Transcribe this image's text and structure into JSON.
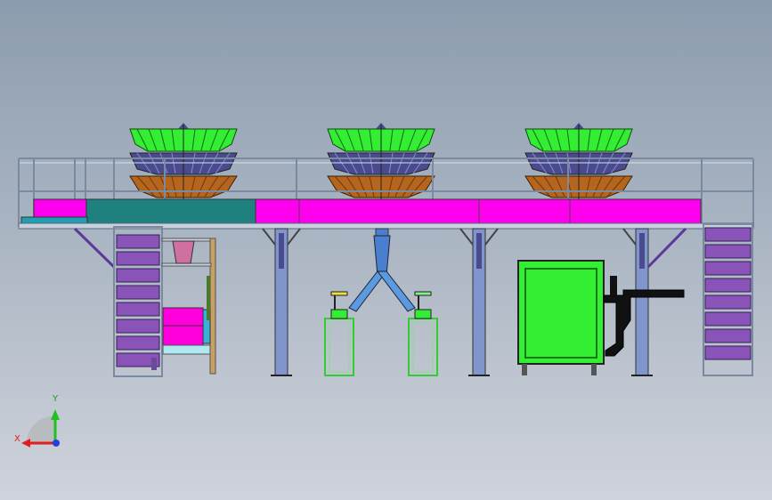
{
  "colors": {
    "frame": "#6c7c90",
    "frame_light": "#c8d2de",
    "hopper_green": "#33ee33",
    "hopper_blue": "#4a4a8e",
    "hopper_brown": "#b5651d",
    "belt_magenta": "#ff00ee",
    "belt_teal": "#1f8080",
    "stair_purple": "#8a53b8",
    "column_blue": "#7f95cc",
    "machine_green": "#33ee33",
    "pipe_black": "#111111",
    "funnel_blue": "#4a7fd0",
    "roller_magenta": "#ff00dd",
    "axis_x": "#e02020",
    "axis_y": "#20c020",
    "axis_z": "#2040e0"
  },
  "triad": {
    "x_label": "X",
    "y_label": "Y"
  },
  "parts": {
    "weigher_count": 3,
    "stair_steps_left": 8,
    "stair_steps_right": 8
  }
}
